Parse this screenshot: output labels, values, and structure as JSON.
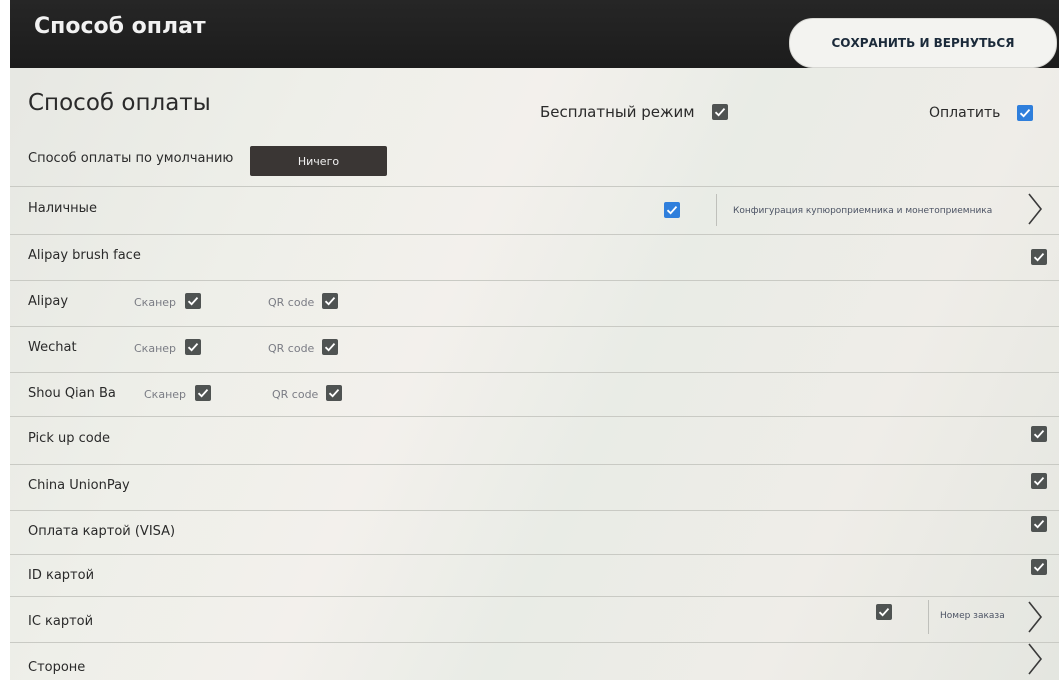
{
  "header": {
    "title": "Способ оплат",
    "save_button": "СОХРАНИТЬ И ВЕРНУТЬСЯ"
  },
  "section": {
    "title": "Способ оплаты",
    "free_mode_label": "Бесплатный режим",
    "free_mode_checked": true,
    "pay_label": "Оплатить",
    "pay_checked": true
  },
  "default_method": {
    "label": "Способ оплаты по умолчанию",
    "value": "Ничего"
  },
  "methods": {
    "cash": {
      "label": "Наличные",
      "checked": true,
      "config": "Конфигурация купюроприемника и монетоприемника"
    },
    "alipay_face": {
      "label": "Alipay brush face",
      "checked": true
    },
    "alipay": {
      "label": "Alipay",
      "scanner_label": "Сканер",
      "scanner_checked": true,
      "qr_label": "QR code",
      "qr_checked": true
    },
    "wechat": {
      "label": "Wechat",
      "scanner_label": "Сканер",
      "scanner_checked": true,
      "qr_label": "QR code",
      "qr_checked": true
    },
    "shouqianba": {
      "label": "Shou Qian Ba",
      "scanner_label": "Сканер",
      "scanner_checked": true,
      "qr_label": "QR code",
      "qr_checked": true
    },
    "pickup": {
      "label": "Pick up code",
      "checked": true
    },
    "unionpay": {
      "label": "China UnionPay",
      "checked": true
    },
    "visa": {
      "label": "Оплата картой (VISA)",
      "checked": true
    },
    "id_card": {
      "label": "ID картой",
      "checked": true
    },
    "ic_card": {
      "label": "IC картой",
      "checked": true,
      "config": "Номер заказа"
    },
    "third_party": {
      "label": "Стороне"
    }
  },
  "colors": {
    "topbar": "#1f1f1f",
    "checkbox_gray": "#4f5352",
    "checkbox_blue": "#2f7fdc"
  }
}
